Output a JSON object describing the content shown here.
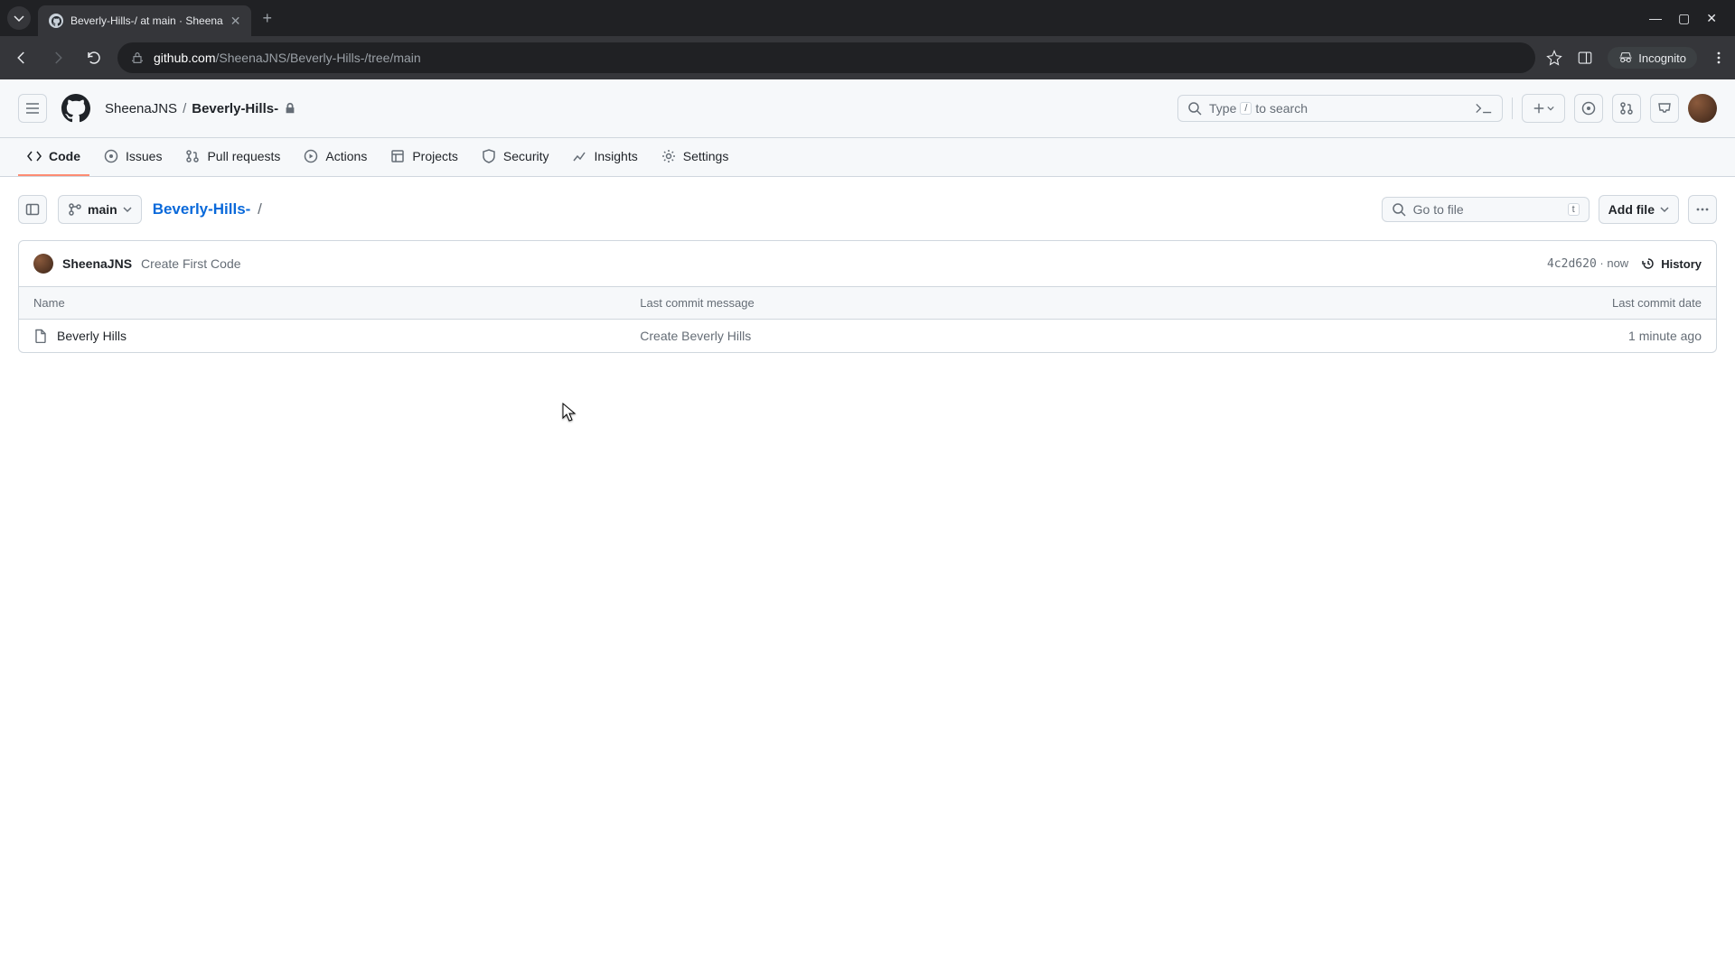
{
  "browser": {
    "tab_title": "Beverly-Hills-/ at main · Sheena",
    "url_domain": "github.com",
    "url_path": "/SheenaJNS/Beverly-Hills-/tree/main",
    "incognito_label": "Incognito"
  },
  "header": {
    "owner": "SheenaJNS",
    "repo": "Beverly-Hills-",
    "search_hint_prefix": "Type",
    "search_hint_key": "/",
    "search_hint_suffix": "to search"
  },
  "tabs": {
    "code": "Code",
    "issues": "Issues",
    "pull_requests": "Pull requests",
    "actions": "Actions",
    "projects": "Projects",
    "security": "Security",
    "insights": "Insights",
    "settings": "Settings"
  },
  "toolbar": {
    "branch": "main",
    "repo_link": "Beverly-Hills-",
    "path_sep": "/",
    "go_to_file": "Go to file",
    "go_to_file_key": "t",
    "add_file": "Add file"
  },
  "commit": {
    "author": "SheenaJNS",
    "message": "Create First Code",
    "sha": "4c2d620",
    "time": "now",
    "history": "History"
  },
  "table": {
    "col_name": "Name",
    "col_msg": "Last commit message",
    "col_date": "Last commit date",
    "rows": [
      {
        "name": "Beverly Hills",
        "msg": "Create Beverly Hills",
        "date": "1 minute ago"
      }
    ]
  }
}
